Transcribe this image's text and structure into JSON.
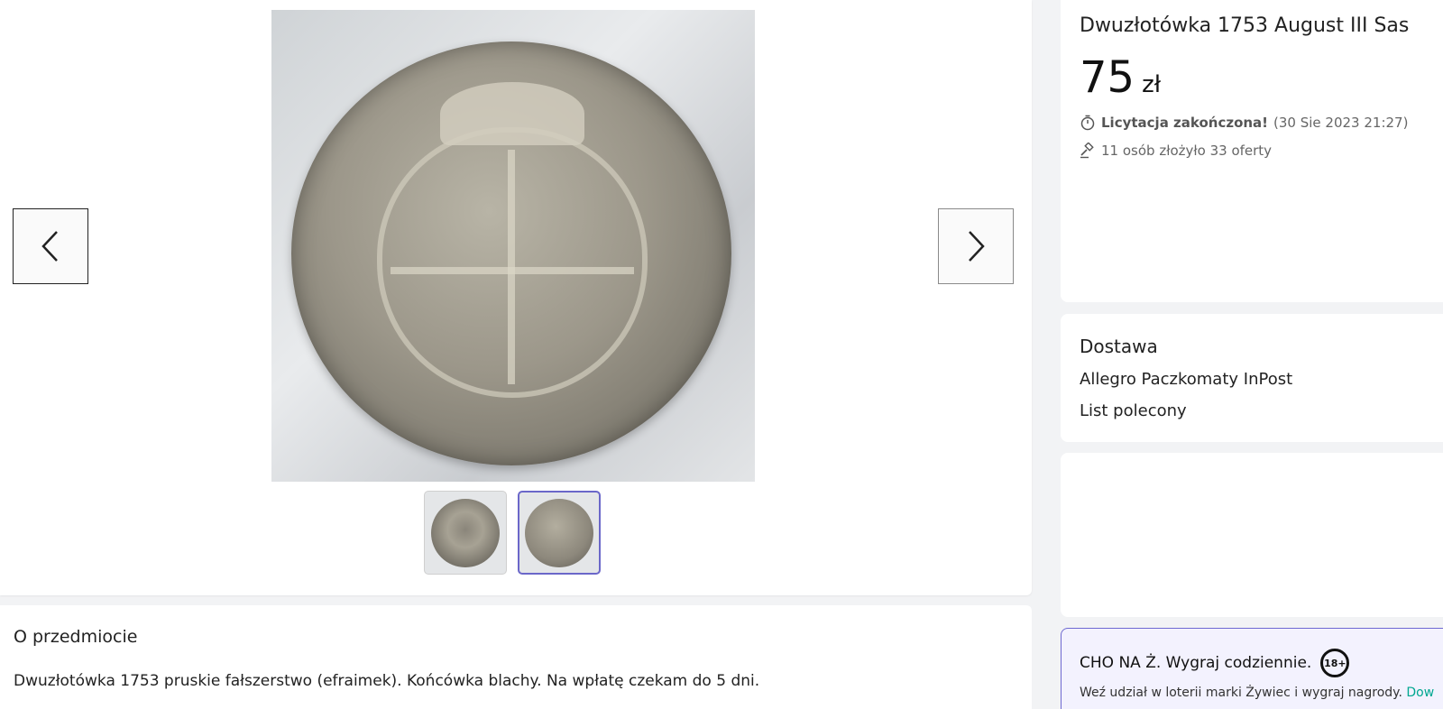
{
  "gallery": {
    "prev_label": "Previous image",
    "next_label": "Next image",
    "thumbnails": [
      "thumbnail-1",
      "thumbnail-2"
    ]
  },
  "description": {
    "title": "O przedmiocie",
    "text": "Dwuzłotówka 1753 pruskie fałszerstwo (efraimek). Końcówka blachy. Na wpłatę czekam do 5 dni."
  },
  "offer": {
    "title": "Dwuzłotówka 1753 August III Sas",
    "price_amount": "75",
    "price_currency": "zł",
    "status_strong": "Licytacja zakończona!",
    "status_date": "(30 Sie 2023 21:27)",
    "bids_text": "11 osób złożyło 33 oferty"
  },
  "delivery": {
    "title": "Dostawa",
    "options": [
      "Allegro Paczkomaty InPost",
      "List polecony"
    ]
  },
  "promo": {
    "title": "CHO NA Ż. Wygraj codziennie.",
    "age": "18+",
    "text": "Weź udział w loterii marki Żywiec i wygraj nagrody.",
    "link": "Dow"
  },
  "colors": {
    "accent": "#6e69d1",
    "link": "#00a790",
    "page_bg": "#f2f3f5"
  }
}
